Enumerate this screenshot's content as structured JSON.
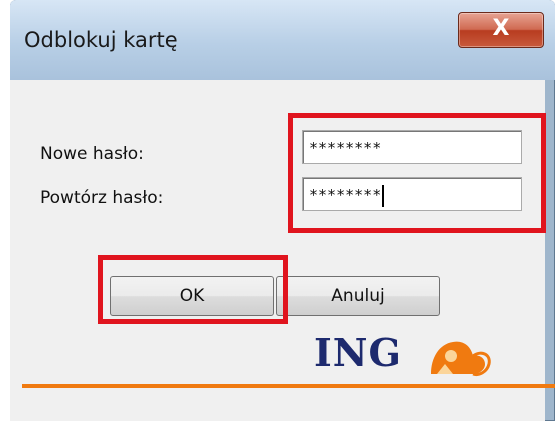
{
  "window": {
    "title": "Odblokuj kartę",
    "close_label": "X"
  },
  "form": {
    "new_password_label": "Nowe hasło:",
    "new_password_value": "********",
    "repeat_password_label": "Powtórz hasło:",
    "repeat_password_value": "********"
  },
  "buttons": {
    "ok_label": "OK",
    "cancel_label": "Anuluj"
  },
  "brand": {
    "logo_text": "ING",
    "logo_color": "#1d2a6e",
    "accent_color": "#f07a10"
  },
  "highlight_color": "#e0141e"
}
